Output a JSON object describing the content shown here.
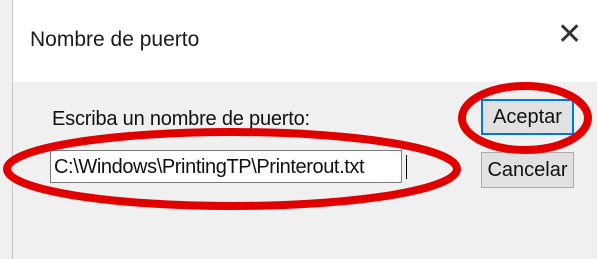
{
  "dialog": {
    "title": "Nombre de puerto",
    "close_glyph": "✕",
    "prompt": "Escriba un nombre de puerto:",
    "port_field": {
      "value": "C:\\Windows\\PrintingTP\\Printerout.txt"
    },
    "ok_label": "Aceptar",
    "cancel_label": "Cancelar"
  },
  "annotations": {
    "color": "#e00000"
  }
}
